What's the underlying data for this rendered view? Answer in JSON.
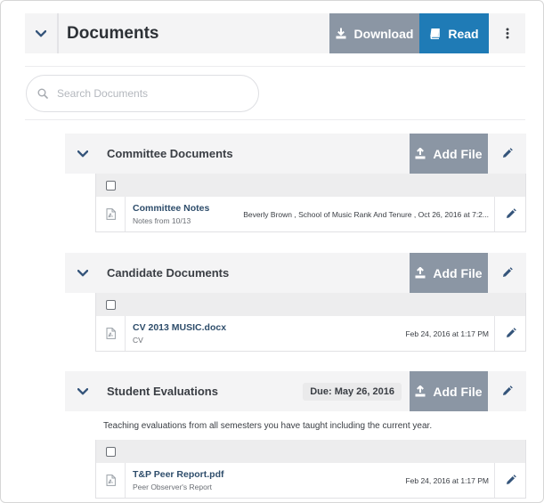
{
  "header": {
    "title": "Documents",
    "download_label": "Download",
    "read_label": "Read"
  },
  "search": {
    "placeholder": "Search Documents"
  },
  "sections": [
    {
      "title": "Committee Documents",
      "add_label": "Add File",
      "files": [
        {
          "name": "Committee Notes",
          "subtitle": "Notes from 10/13",
          "meta": "Beverly Brown , School of Music Rank And Tenure , Oct 26, 2016 at 7:2..."
        }
      ]
    },
    {
      "title": "Candidate Documents",
      "add_label": "Add File",
      "files": [
        {
          "name": "CV 2013 MUSIC.docx",
          "subtitle": "CV",
          "meta": "Feb 24, 2016 at 1:17 PM"
        }
      ]
    },
    {
      "title": "Student Evaluations",
      "due": "Due: May 26, 2016",
      "add_label": "Add File",
      "description": "Teaching evaluations from all semesters you have taught including the current year.",
      "files": [
        {
          "name": "T&P Peer Report.pdf",
          "subtitle": "Peer Observer's Report",
          "meta": "Feb 24, 2016 at 1:17 PM"
        }
      ]
    }
  ],
  "colors": {
    "gray_button": "#8b96a4",
    "read_button": "#1f7bb6",
    "header_bg": "#f4f4f5",
    "chevron": "#34547a"
  }
}
